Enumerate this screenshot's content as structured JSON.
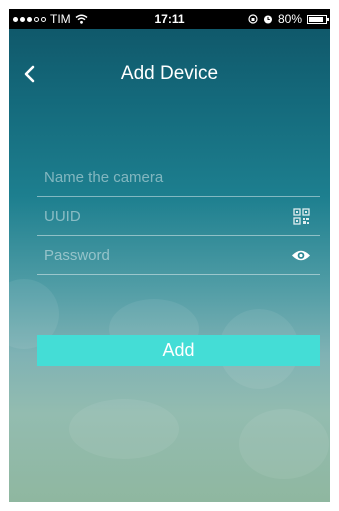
{
  "status_bar": {
    "carrier": "TIM",
    "time": "17:11",
    "battery_percent": "80%"
  },
  "header": {
    "title": "Add Device"
  },
  "form": {
    "name_placeholder": "Name the camera",
    "uuid_placeholder": "UUID",
    "password_placeholder": "Password",
    "name_value": "",
    "uuid_value": "",
    "password_value": ""
  },
  "add_button_label": "Add",
  "colors": {
    "accent": "#44ddd6",
    "background_top": "#0f5466",
    "background_bottom": "#8fb7a0"
  },
  "icons": [
    "back-icon",
    "qr-code-icon",
    "eye-icon",
    "wifi-icon",
    "alarm-icon",
    "battery-icon"
  ]
}
